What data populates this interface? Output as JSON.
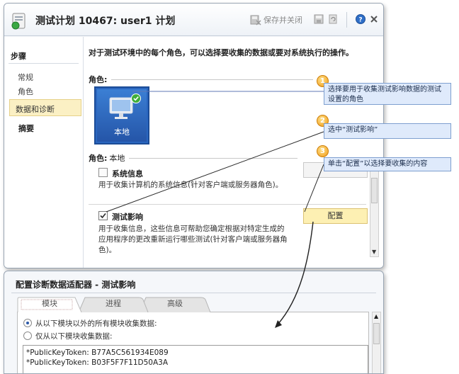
{
  "window": {
    "title": "测试计划 10467: user1 计划",
    "toolbar": {
      "save_close": "保存并关闭"
    }
  },
  "nav": {
    "header": "步骤",
    "items": [
      {
        "label": "常规"
      },
      {
        "label": "角色"
      },
      {
        "label": "数据和诊断",
        "selected": true
      }
    ],
    "summary": "摘要"
  },
  "content": {
    "instruction": "对于测试环境中的每个角色，可以选择要收集的数据或要对系统执行的操作。",
    "roles_header": "角色:",
    "role_tile_label": "本地",
    "role_prefix": "角色:",
    "role_value": "本地",
    "adapters": [
      {
        "title": "系统信息",
        "checked": false,
        "desc": "用于收集计算机的系统信息(针对客户端或服务器角色)。"
      },
      {
        "title": "测试影响",
        "checked": true,
        "desc": "用于收集信息，这些信息可帮助您确定根据对特定生成的应用程序的更改重新运行哪些测试(针对客户端或服务器角色)。",
        "button": "配置"
      }
    ]
  },
  "callouts": [
    {
      "num": "1",
      "text": "选择要用于收集测试影响数据的测试设置的角色"
    },
    {
      "num": "2",
      "text": "选中“测试影响”"
    },
    {
      "num": "3",
      "text": "单击“配置”以选择要收集的内容"
    }
  ],
  "dialog": {
    "title": "配置诊断数据适配器 - 测试影响",
    "tabs": [
      {
        "label": "模块",
        "active": true
      },
      {
        "label": "进程",
        "active": false
      },
      {
        "label": "高级",
        "active": false
      }
    ],
    "options": [
      {
        "label": "从以下模块以外的所有模块收集数据:",
        "selected": true
      },
      {
        "label": "仅从以下模块收集数据:",
        "selected": false
      }
    ],
    "modules": [
      "*PublicKeyToken: B77A5C561934E089",
      "*PublicKeyToken: B03F5F7F11D50A3A"
    ]
  },
  "colors": {
    "accent_blue": "#2a66bf",
    "callout_fill": "#dfeafb",
    "callout_border": "#7e9fcf",
    "callout_number": "#f29b16",
    "selected_nav": "#fbf0c4",
    "configure_button": "#fdf0b3"
  }
}
